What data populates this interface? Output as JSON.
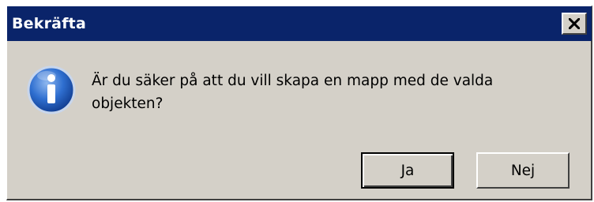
{
  "window": {
    "title": "Bekräfta"
  },
  "icon": "info-icon",
  "message": "Är du säker på att du vill skapa en mapp med de valda objekten?",
  "buttons": {
    "yes_label": "Ja",
    "no_label": "Nej"
  },
  "colors": {
    "titlebar": "#0a246a",
    "dialog_bg": "#d4d0c8",
    "icon_blue": "#1f5fbf"
  }
}
